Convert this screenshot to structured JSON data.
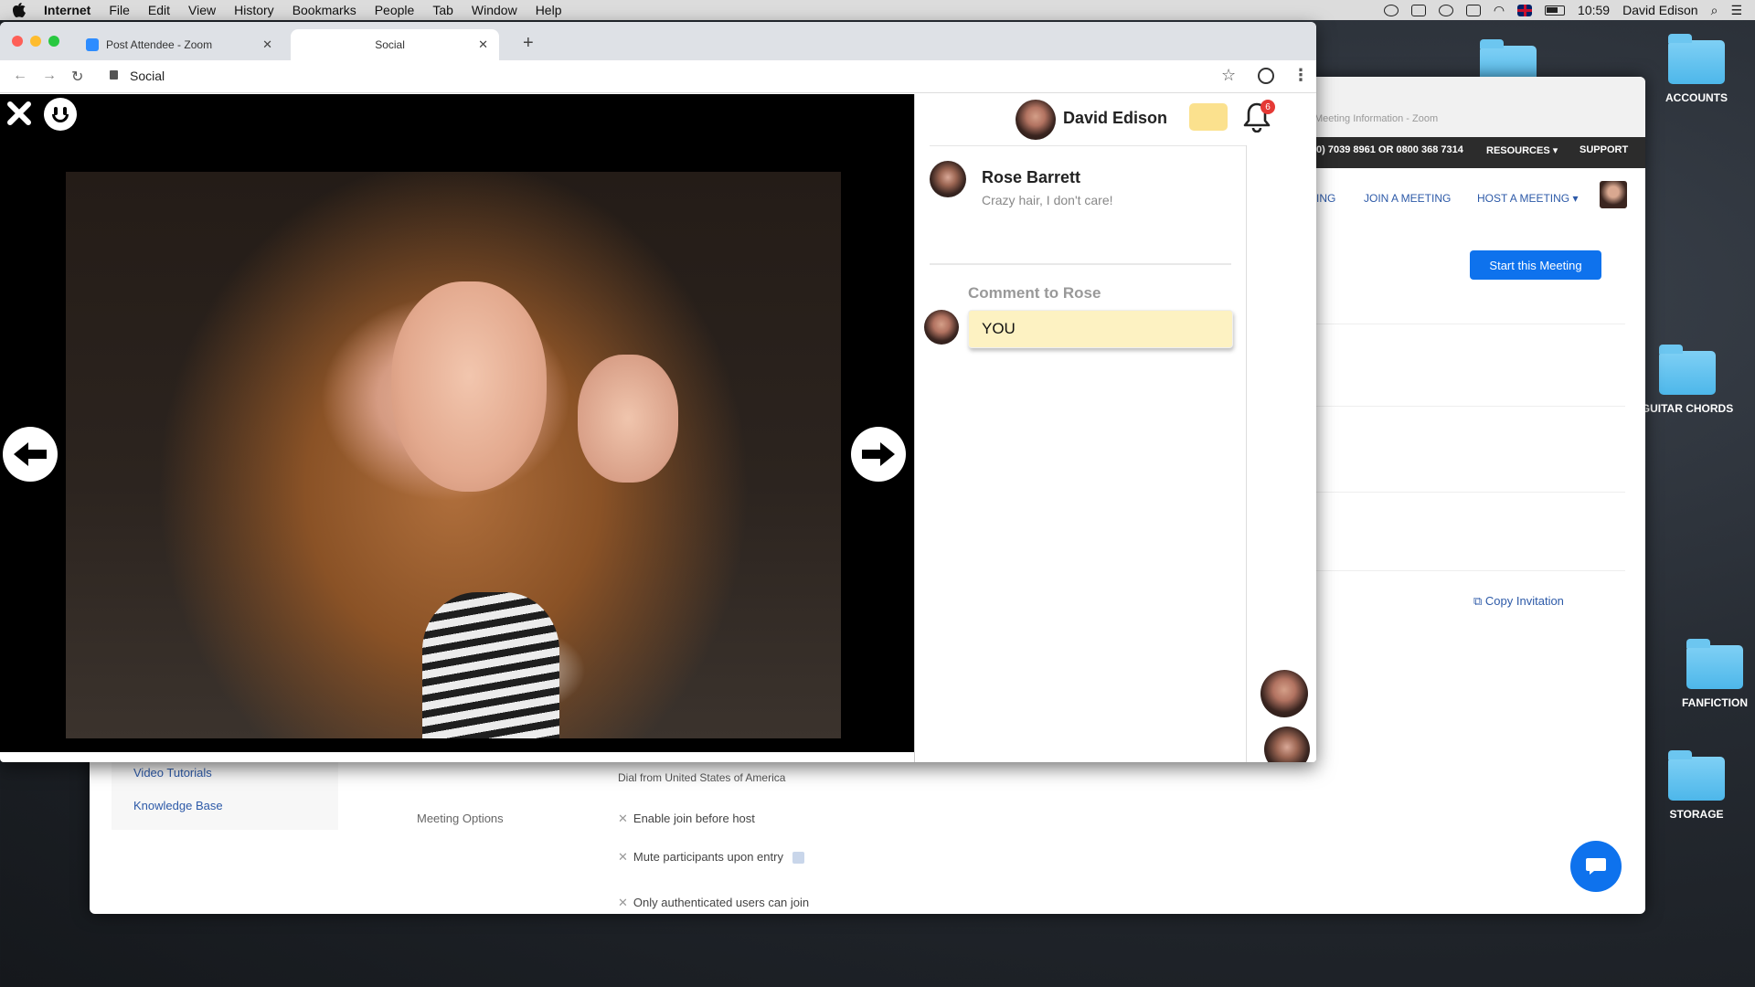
{
  "menubar": {
    "app_name": "Internet",
    "items": [
      "File",
      "Edit",
      "View",
      "History",
      "Bookmarks",
      "People",
      "Tab",
      "Window",
      "Help"
    ],
    "clock": "10:59",
    "user": "David Edison"
  },
  "desktop": {
    "folders": [
      "ACCOUNTS",
      "GUITAR CHORDS",
      "FANFICTION",
      "STORAGE"
    ]
  },
  "background_window": {
    "tab_title": "Meeting Information - Zoom",
    "phone": "0) 7039 8961 OR 0800 368 7314",
    "resources": "RESOURCES ▾",
    "support": "SUPPORT",
    "nav_partial": "ING",
    "join_meeting": "JOIN A MEETING",
    "host_meeting": "HOST A MEETING ▾",
    "start_button": "Start this Meeting",
    "copy_invitation": "Copy Invitation",
    "video_tutorials": "Video Tutorials",
    "knowledge_base": "Knowledge Base",
    "dial_from": "Dial from United States of America",
    "meeting_options": "Meeting Options",
    "options": [
      "Enable join before host",
      "Mute participants upon entry",
      "Only authenticated users can join"
    ]
  },
  "browser": {
    "tabs": [
      {
        "title": "Post Attendee - Zoom"
      },
      {
        "title": "Social"
      }
    ],
    "url": "Social"
  },
  "social": {
    "user_name": "David Edison",
    "notification_count": "6",
    "post": {
      "author": "Rose Barrett",
      "caption": "Crazy hair, I don't care!"
    },
    "comment": {
      "title": "Comment to Rose",
      "value": "YOU"
    }
  },
  "colors": {
    "zoom_blue": "#0e72ed",
    "comment_bg": "#fdf2c2",
    "message_icon": "#fbe18e",
    "badge_red": "#e53935"
  }
}
